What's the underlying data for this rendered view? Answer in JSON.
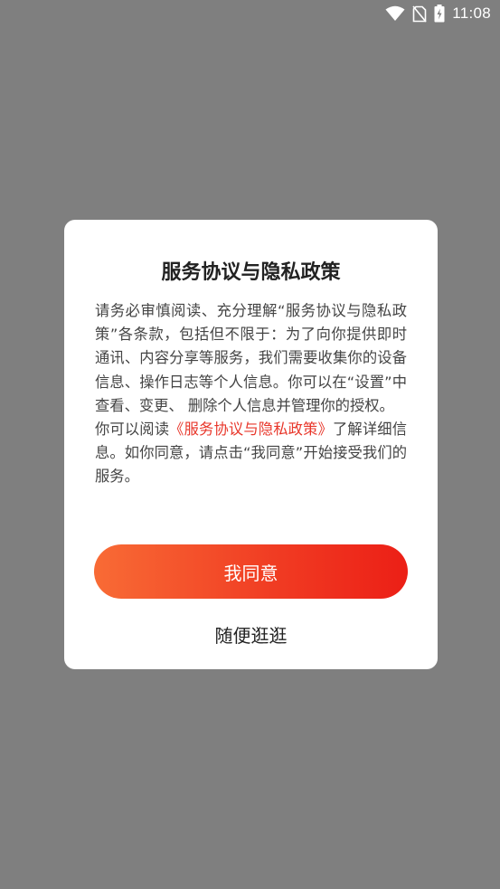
{
  "status_bar": {
    "time": "11:08",
    "icons": [
      "wifi-icon",
      "no-sim-icon",
      "battery-charging-icon"
    ]
  },
  "dialog": {
    "title": "服务协议与隐私政策",
    "body_paragraph_1": "请务必审慎阅读、充分理解“服务协议与隐私政策”各条款，包括但不限于：为了向你提供即时通讯、内容分享等服务，我们需要收集你的设备信息、操作日志等个人信息。你可以在“设置”中查看、变更、 删除个人信息并管理你的授权。",
    "body_paragraph_2_prefix": "你可以阅读",
    "policy_link": "《服务协议与隐私政策》",
    "body_paragraph_2_suffix": "了解详细信息。如你同意，请点击“我同意”开始接受我们的服务。",
    "agree_button": "我同意",
    "browse_button": "随便逛逛"
  },
  "colors": {
    "overlay": "#7f7f7f",
    "dialog_background": "#ffffff",
    "accent_link": "#e8362a",
    "button_gradient_start": "#f86b35",
    "button_gradient_end": "#ec1f16"
  }
}
